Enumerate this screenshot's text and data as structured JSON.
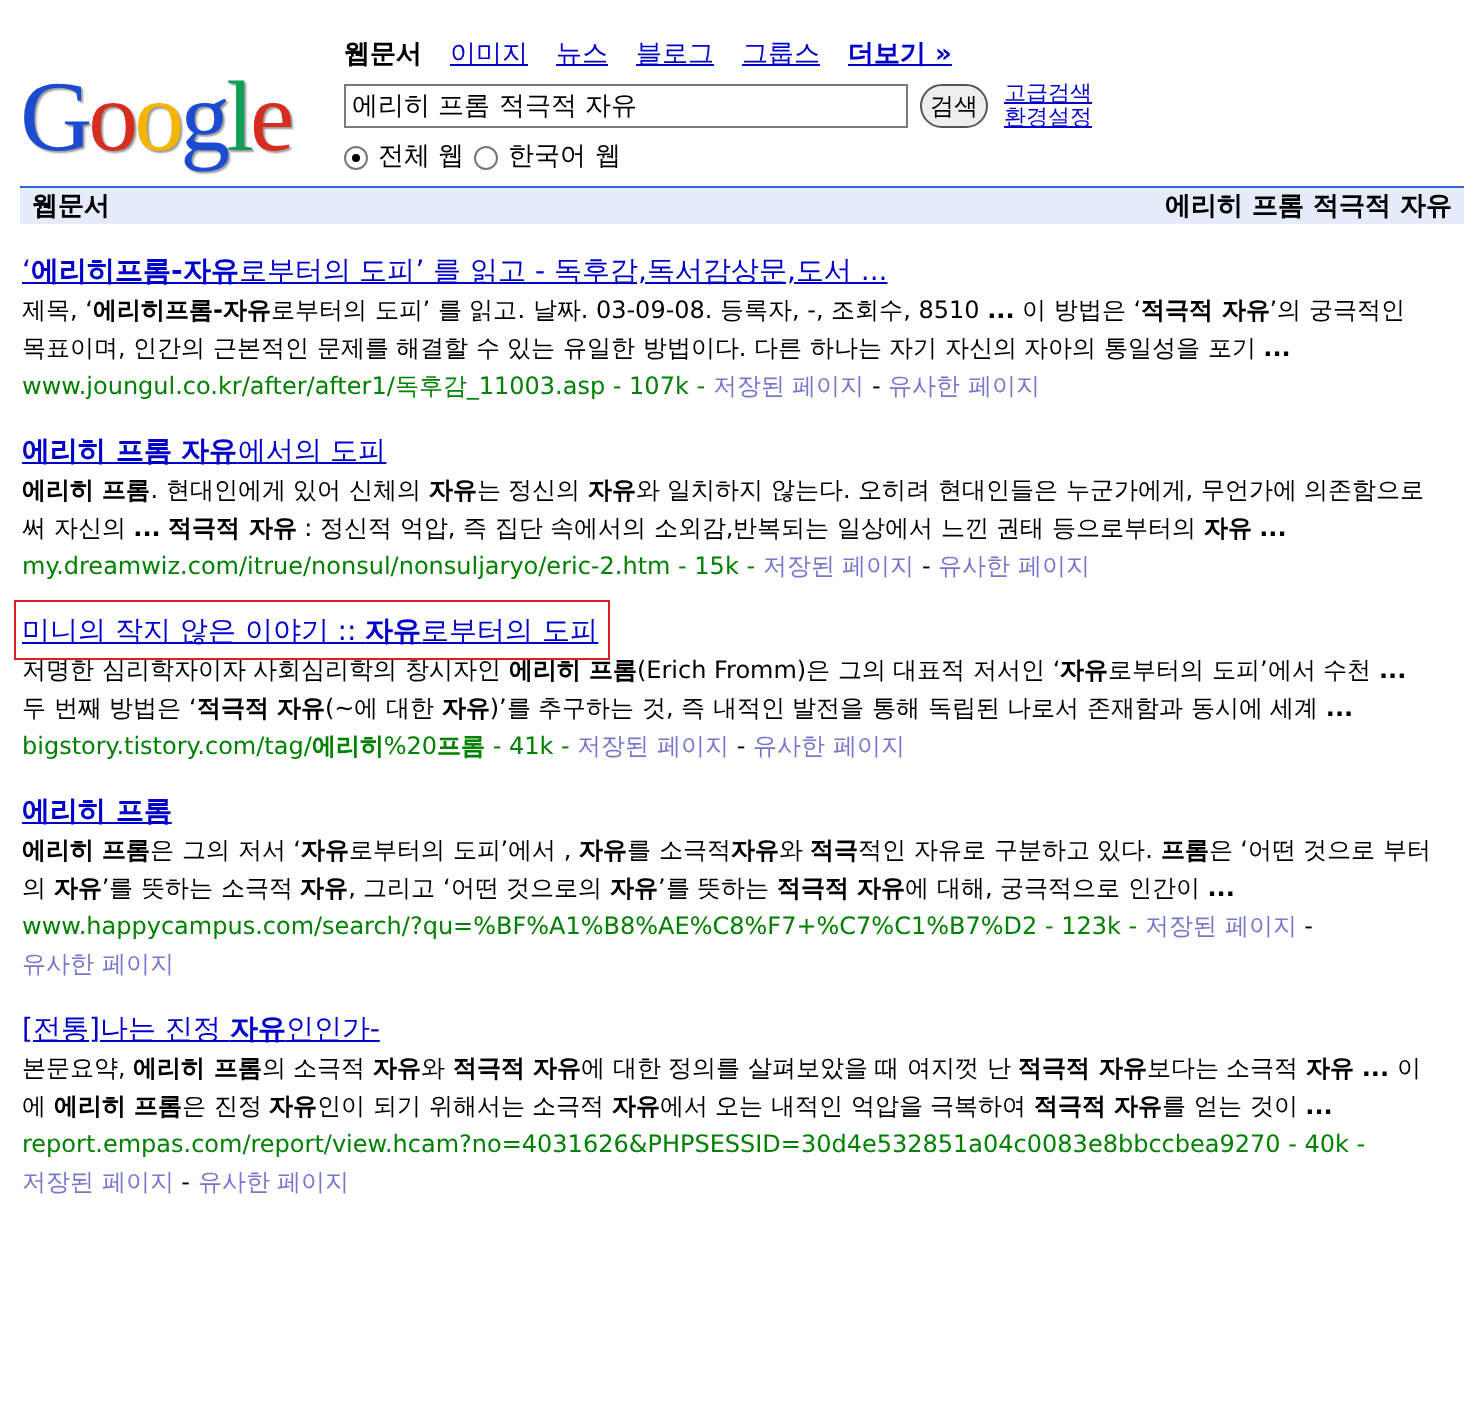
{
  "logo": "Google",
  "nav": [
    {
      "label": "웹문서",
      "selected": true,
      "kind": "tab"
    },
    {
      "label": "이미지",
      "selected": false,
      "kind": "tab"
    },
    {
      "label": "뉴스",
      "selected": false,
      "kind": "tab"
    },
    {
      "label": "블로그",
      "selected": false,
      "kind": "tab"
    },
    {
      "label": "그룹스",
      "selected": false,
      "kind": "tab"
    },
    {
      "label": "더보기 »",
      "selected": false,
      "kind": "more"
    }
  ],
  "search": {
    "value": "에리히 프롬 적극적 자유",
    "button": "검색",
    "links": [
      "고급검색",
      "환경설정"
    ]
  },
  "scope": [
    {
      "label": "전체 웹",
      "selected": true
    },
    {
      "label": "한국어 웹",
      "selected": false
    }
  ],
  "results_bar": {
    "title": "웹문서",
    "query": "에리히 프롬 적극적 자유"
  },
  "results": [
    {
      "title": "‘**에리히프롬-자유**로부터의 도피’ 를 읽고 - 독후감,독서감상문,도서 ...",
      "annotated": false,
      "snippet": "제목, ‘**에리히프롬-자유**로부터의 도피’ 를 읽고. 날짜. 03-09-08. 등록자, -, 조회수, 8510 **...** 이 방법은 ‘**적극적 자유**’의 궁극적인 목표이며, 인간의 근본적인 문제를 해결할 수 있는 유일한 방법이다. 다른 하나는 자기 자신의 자아의 통일성을 포기 **...**",
      "url": "www.joungul.co.kr/after/after1/독후감_11003.asp - 107k -",
      "separator": "-",
      "cached": "저장된 페이지",
      "similar": "유사한 페이지"
    },
    {
      "title": "**에리히 프롬 자유**에서의 도피",
      "annotated": false,
      "snippet": "**에리히 프롬**. 현대인에게 있어 신체의 **자유**는 정신의 **자유**와 일치하지 않는다. 오히려 현대인들은 누군가에게, 무언가에 의존함으로써 자신의 **...** **적극적 자유** : 정신적 억압, 즉 집단 속에서의 소외감,반복되는 일상에서 느낀 권태 등으로부터의 **자유** **...**",
      "url": "my.dreamwiz.com/itrue/nonsul/nonsuljaryo/eric-2.htm - 15k -",
      "separator": "-",
      "cached": "저장된 페이지",
      "similar": "유사한 페이지"
    },
    {
      "title": "미니의 작지 않은 이야기 :: **자유**로부터의 도피",
      "annotated": true,
      "snippet": "저명한 심리학자이자 사회심리학의 창시자인 **에리히 프롬**(Erich Fromm)은 그의 대표적 저서인 ‘**자유**로부터의 도피’에서 수천 **...** 두 번째 방법은 ‘**적극적 자유**(~에 대한 **자유**)’를 추구하는 것, 즉 내적인 발전을 통해 독립된 나로서 존재함과 동시에 세계 **...**",
      "url": "bigstory.tistory.com/tag/**에리히**%20**프롬** - 41k -",
      "separator": "-",
      "cached": "저장된 페이지",
      "similar": "유사한 페이지"
    },
    {
      "title": "**에리히 프롬**",
      "annotated": false,
      "snippet": "**에리히 프롬**은 그의 저서 ‘**자유**로부터의 도피’에서 , **자유**를 소극적**자유**와 **적극**적인 자유로 구분하고 있다. **프롬**은 ‘어떤 것으로 부터의 **자유**’를 뜻하는 소극적 **자유**, 그리고 ‘어떤 것으로의 **자유**’를 뜻하는 **적극적 자유**에 대해, 궁극적으로 인간이 **...**",
      "url": "www.happycampus.com/search/?qu=%BF%A1%B8%AE%C8%F7+%C7%C1%B7%D2 - 123k -",
      "separator": "-",
      "cached": "저장된 페이지",
      "similar": "유사한 페이지"
    },
    {
      "title": "[전통]나는 진정 **자유**인인가-",
      "annotated": false,
      "snippet": "본문요약, **에리히 프롬**의 소극적 **자유**와 **적극적 자유**에 대한 정의를 살펴보았을 때 여지껏 난 **적극적 자유**보다는 소극적 **자유** **...** 이에 **에리히 프롬**은 진정 **자유**인이 되기 위해서는 소극적 **자유**에서 오는 내적인 억압을 극복하여 **적극적 자유**를 얻는 것이 **...**",
      "url": "report.empas.com/report/view.hcam?no=4031626&PHPSESSID=30d4e532851a04c0083e8bbccbea9270 - 40k -",
      "separator": "-",
      "cached": "저장된 페이지",
      "similar": "유사한 페이지"
    }
  ]
}
